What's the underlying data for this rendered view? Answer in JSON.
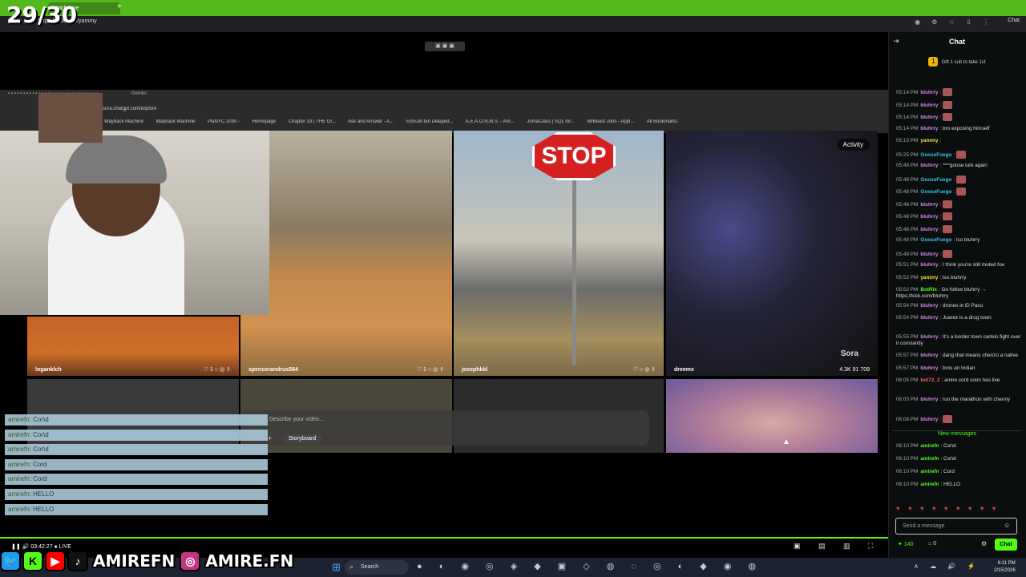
{
  "overlay": {
    "counter": "29/30"
  },
  "browser": {
    "tab_title": "Watch Live",
    "url": "https://kick.com/yammy",
    "profile_label": "Chat"
  },
  "inner_browser": {
    "url": "https://sora.chatgpt.com/explore",
    "bookmarks": [
      "Wayback Machine",
      "Wayback Machine",
      "PlaNYC 2030 -",
      "Homepage",
      "Chapter 33 | THE Ol...",
      "Ask and Answer - A...",
      "ElonJet but Delayed...",
      "A.E.A.O.N.M.S. - Am...",
      "JomaClass | SQL for...",
      "MrBeast Jobs - Appl...",
      "All Bookmarks"
    ],
    "gemini": "Gemini"
  },
  "sora": {
    "activity_label": "Activity",
    "watermark": "Sora",
    "tiles": [
      {
        "user": "loganklch",
        "stats": "1"
      },
      {
        "user": "spencerandrus564",
        "stats": "1"
      },
      {
        "user": "josephkkl",
        "stats": ""
      },
      {
        "user": "dreemx",
        "stats": "4.3K  91  709"
      }
    ],
    "stop_text": "STOP",
    "prompt_placeholder": "Describe your video...",
    "storyboard_label": "Storyboard"
  },
  "overlay_chat": [
    {
      "user": "amirefn",
      "text": "Cor\\d"
    },
    {
      "user": "amirefn",
      "text": "Cor\\d"
    },
    {
      "user": "amirefn",
      "text": "Cor\\d"
    },
    {
      "user": "amirefn",
      "text": "Cord"
    },
    {
      "user": "amirefn",
      "text": "Cord"
    },
    {
      "user": "amirefn",
      "text": "HELLO"
    },
    {
      "user": "amirefn",
      "text": "HELLO"
    }
  ],
  "player": {
    "timestamp": "03:42:27",
    "live": "LIVE"
  },
  "socials": {
    "handle1": "AMIREFN",
    "handle2": "AMIRE.FN"
  },
  "chat": {
    "title": "Chat",
    "gift_text": "Gift 1 sub to take 1st",
    "messages": [
      {
        "time": "05:14 PM",
        "user": "bluhrry",
        "color": "#d68ae8",
        "text": "",
        "emote": true
      },
      {
        "time": "05:14 PM",
        "user": "bluhrry",
        "color": "#d68ae8",
        "text": "",
        "emote": true
      },
      {
        "time": "05:14 PM",
        "user": "bluhrry",
        "color": "#d68ae8",
        "text": "",
        "emote": true
      },
      {
        "time": "05:14 PM",
        "user": "bluhrry",
        "color": "#d68ae8",
        "text": "bro exposing himself",
        "emote": false
      },
      {
        "time": "05:15 PM",
        "user": "yammy",
        "color": "#f0e02a",
        "text": "",
        "emote": false
      },
      {
        "time": "05:25 PM",
        "user": "GooseFuego",
        "color": "#39c3e8",
        "text": "",
        "emote": true
      },
      {
        "time": "05:48 PM",
        "user": "bluhrry",
        "color": "#d68ae8",
        "text": "^^^goose lurk again",
        "emote": false
      },
      {
        "time": "05:48 PM",
        "user": "GooseFuego",
        "color": "#39c3e8",
        "text": "",
        "emote": true
      },
      {
        "time": "05:48 PM",
        "user": "GooseFuego",
        "color": "#39c3e8",
        "text": "",
        "emote": true
      },
      {
        "time": "05:48 PM",
        "user": "bluhrry",
        "color": "#d68ae8",
        "text": "",
        "emote": true
      },
      {
        "time": "05:48 PM",
        "user": "bluhrry",
        "color": "#d68ae8",
        "text": "",
        "emote": true
      },
      {
        "time": "05:48 PM",
        "user": "bluhrry",
        "color": "#d68ae8",
        "text": "",
        "emote": true
      },
      {
        "time": "05:48 PM",
        "user": "GooseFuego",
        "color": "#39c3e8",
        "text": "lso bluhrry",
        "emote": false
      },
      {
        "time": "05:49 PM",
        "user": "bluhrry",
        "color": "#d68ae8",
        "text": "",
        "emote": true
      },
      {
        "time": "05:51 PM",
        "user": "bluhrry",
        "color": "#d68ae8",
        "text": "I think you're still muted foe",
        "emote": false
      },
      {
        "time": "05:52 PM",
        "user": "yammy",
        "color": "#f0e02a",
        "text": "lso bluhrry",
        "emote": false
      },
      {
        "time": "05:52 PM",
        "user": "BotRix",
        "color": "#53fc18",
        "text": "Go follow bluhrry → https://kick.com/bluhrry",
        "emote": false
      },
      {
        "time": "05:54 PM",
        "user": "bluhrry",
        "color": "#d68ae8",
        "text": "drones in El Paso",
        "emote": false
      },
      {
        "time": "05:54 PM",
        "user": "bluhrry",
        "color": "#d68ae8",
        "text": "Juarez is a drug town",
        "emote": false
      },
      {
        "time": "05:55 PM",
        "user": "bluhrry",
        "color": "#d68ae8",
        "text": "It's a border town cartels fight over it constantly",
        "emote": false
      },
      {
        "time": "05:57 PM",
        "user": "bluhrry",
        "color": "#d68ae8",
        "text": "dang that means chenzo a native",
        "emote": false
      },
      {
        "time": "05:57 PM",
        "user": "bluhrry",
        "color": "#d68ae8",
        "text": "bros an Indian",
        "emote": false
      },
      {
        "time": "06:05 PM",
        "user": "bot72_2",
        "color": "#ff5c5c",
        "text": "amire cord soon hes live",
        "emote": false
      },
      {
        "time": "06:05 PM",
        "user": "bluhrry",
        "color": "#d68ae8",
        "text": "run the marathon with chenny",
        "emote": false
      },
      {
        "time": "06:08 PM",
        "user": "bluhrry",
        "color": "#d68ae8",
        "text": "",
        "emote": true
      }
    ],
    "new_messages_label": "New messages",
    "recent": [
      {
        "time": "06:10 PM",
        "user": "amirefn",
        "text": "Cor\\d"
      },
      {
        "time": "06:10 PM",
        "user": "amirefn",
        "text": "Cor\\d"
      },
      {
        "time": "06:10 PM",
        "user": "amirefn",
        "text": "Cord"
      },
      {
        "time": "06:10 PM",
        "user": "amirefn",
        "text": "HELLO"
      }
    ],
    "send_placeholder": "Send a message",
    "points": "140",
    "count": "0",
    "chat_button": "Chat"
  },
  "taskbar": {
    "search_label": "Search",
    "time": "6:11 PM",
    "date": "2/15/2026"
  }
}
